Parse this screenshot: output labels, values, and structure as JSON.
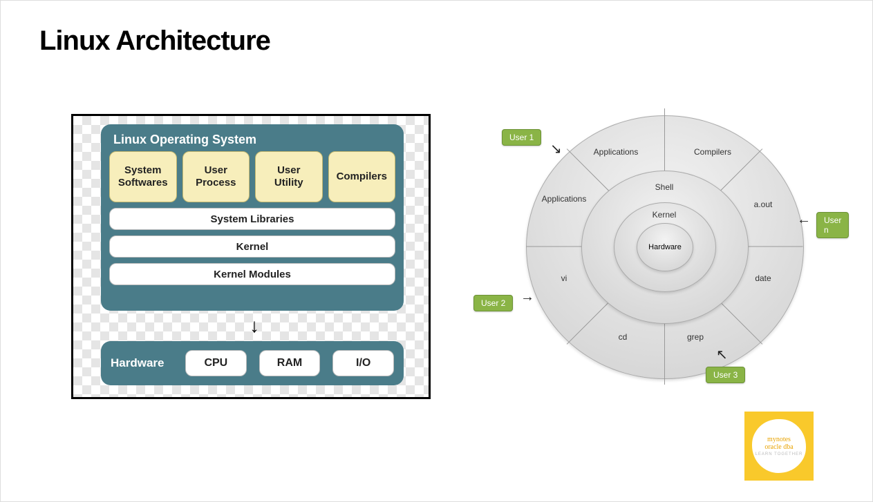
{
  "title": "Linux Architecture",
  "left_diagram": {
    "os_panel_title": "Linux Operating System",
    "top_boxes": [
      "System\nSoftwares",
      "User\nProcess",
      "User\nUtility",
      "Compilers"
    ],
    "wide_boxes": [
      "System Libraries",
      "Kernel",
      "Kernel Modules"
    ],
    "hardware_label": "Hardware",
    "hardware_boxes": [
      "CPU",
      "RAM",
      "I/O"
    ]
  },
  "right_diagram": {
    "center_rings": [
      "Hardware",
      "Kernel",
      "Shell"
    ],
    "outer_segments": [
      "Applications",
      "Compilers",
      "a.out",
      "date",
      "grep",
      "cd",
      "vi",
      "Applications"
    ],
    "users": [
      "User 1",
      "User 2",
      "User 3",
      "User n"
    ]
  },
  "logo": {
    "line1": "mynotes",
    "line2": "oracle dba",
    "sub": "LEARN TOGETHER"
  }
}
